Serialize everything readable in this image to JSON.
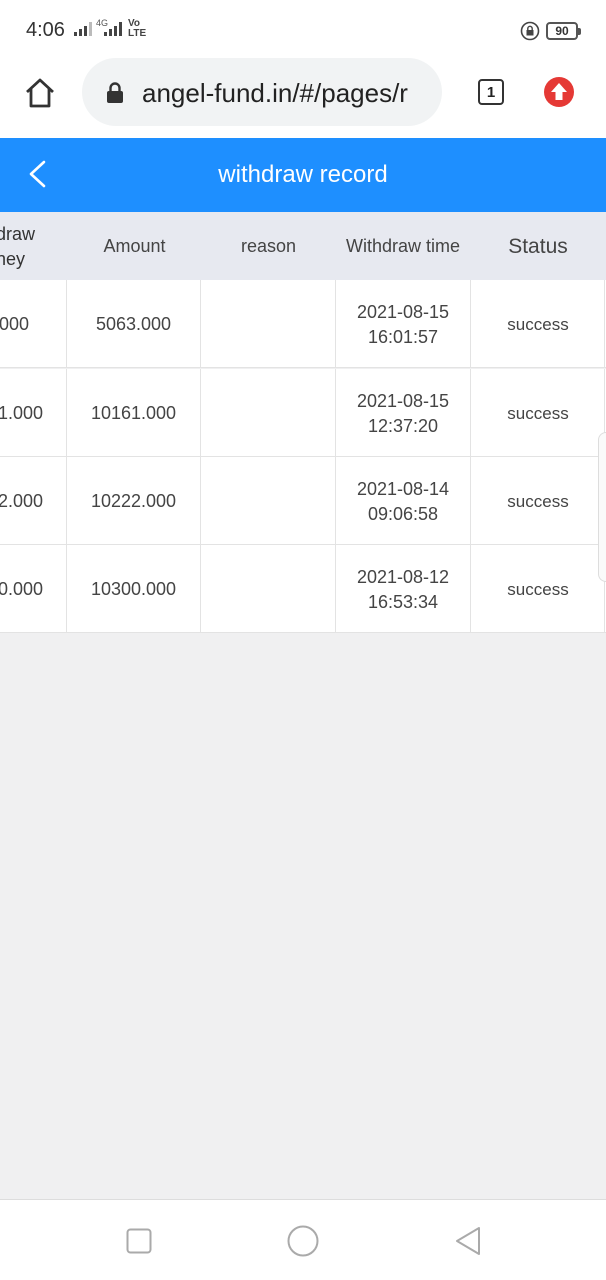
{
  "status_bar": {
    "time": "4:06",
    "network_label": "4G",
    "volte_label": "Vo LTE",
    "battery": "90"
  },
  "browser": {
    "url": "angel-fund.in/#/pages/r",
    "tab_count": "1"
  },
  "header": {
    "title": "withdraw record"
  },
  "table": {
    "columns": [
      "draw ney",
      "Amount",
      "reason",
      "Withdraw time",
      "Status"
    ],
    "rows": [
      {
        "money": ".000",
        "amount": "5063.000",
        "reason": "",
        "date": "2021-08-15",
        "time": "16:01:57",
        "status": "success"
      },
      {
        "money": "1.000",
        "amount": "10161.000",
        "reason": "",
        "date": "2021-08-15",
        "time": "12:37:20",
        "status": "success"
      },
      {
        "money": "2.000",
        "amount": "10222.000",
        "reason": "",
        "date": "2021-08-14",
        "time": "09:06:58",
        "status": "success"
      },
      {
        "money": "0.000",
        "amount": "10300.000",
        "reason": "",
        "date": "2021-08-12",
        "time": "16:53:34",
        "status": "success"
      }
    ]
  },
  "colors": {
    "header_blue": "#1e8fff",
    "upload_red": "#e53935",
    "page_bg": "#f0f0f1"
  }
}
